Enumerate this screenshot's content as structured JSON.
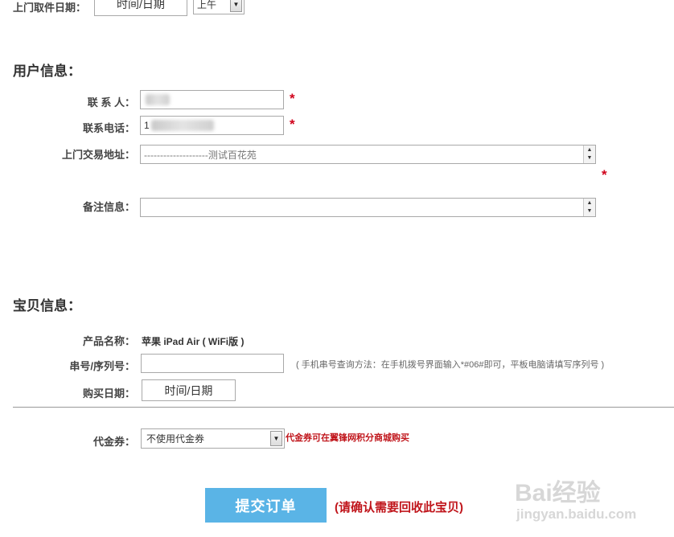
{
  "pickup_date": {
    "label": "上门取件日期：",
    "date_placeholder": "时间/日期",
    "period_value": "上午"
  },
  "user_info": {
    "heading": "用户信息：",
    "contact_label": "联 系 人：",
    "phone_label": "联系电话：",
    "phone_value_visible": "1",
    "address_label": "上门交易地址：",
    "address_value": "--------------------测试百花苑",
    "remarks_label": "备注信息：",
    "required_mark": "*"
  },
  "item_info": {
    "heading": "宝贝信息：",
    "product_label": "产品名称：",
    "product_value": "苹果 iPad Air ( WiFi版 )",
    "serial_label": "串号/序列号：",
    "serial_hint": "( 手机串号查询方法：在手机拨号界面输入*#06#即可，平板电脑请填写序列号 )",
    "purchase_date_label": "购买日期：",
    "purchase_date_placeholder": "时间/日期"
  },
  "voucher": {
    "label": "代金券：",
    "selected": "不使用代金券",
    "note": "代金券可在翼锋网积分商城购买"
  },
  "submit": {
    "button_label": "提交订单",
    "confirm_text": "(请确认需要回收此宝贝)"
  },
  "watermark": {
    "logo": "Bai经验",
    "url": "jingyan.baidu.com"
  },
  "colors": {
    "submit_bg": "#5ab4e6",
    "required": "#d0021b",
    "warning": "#c0151b"
  }
}
